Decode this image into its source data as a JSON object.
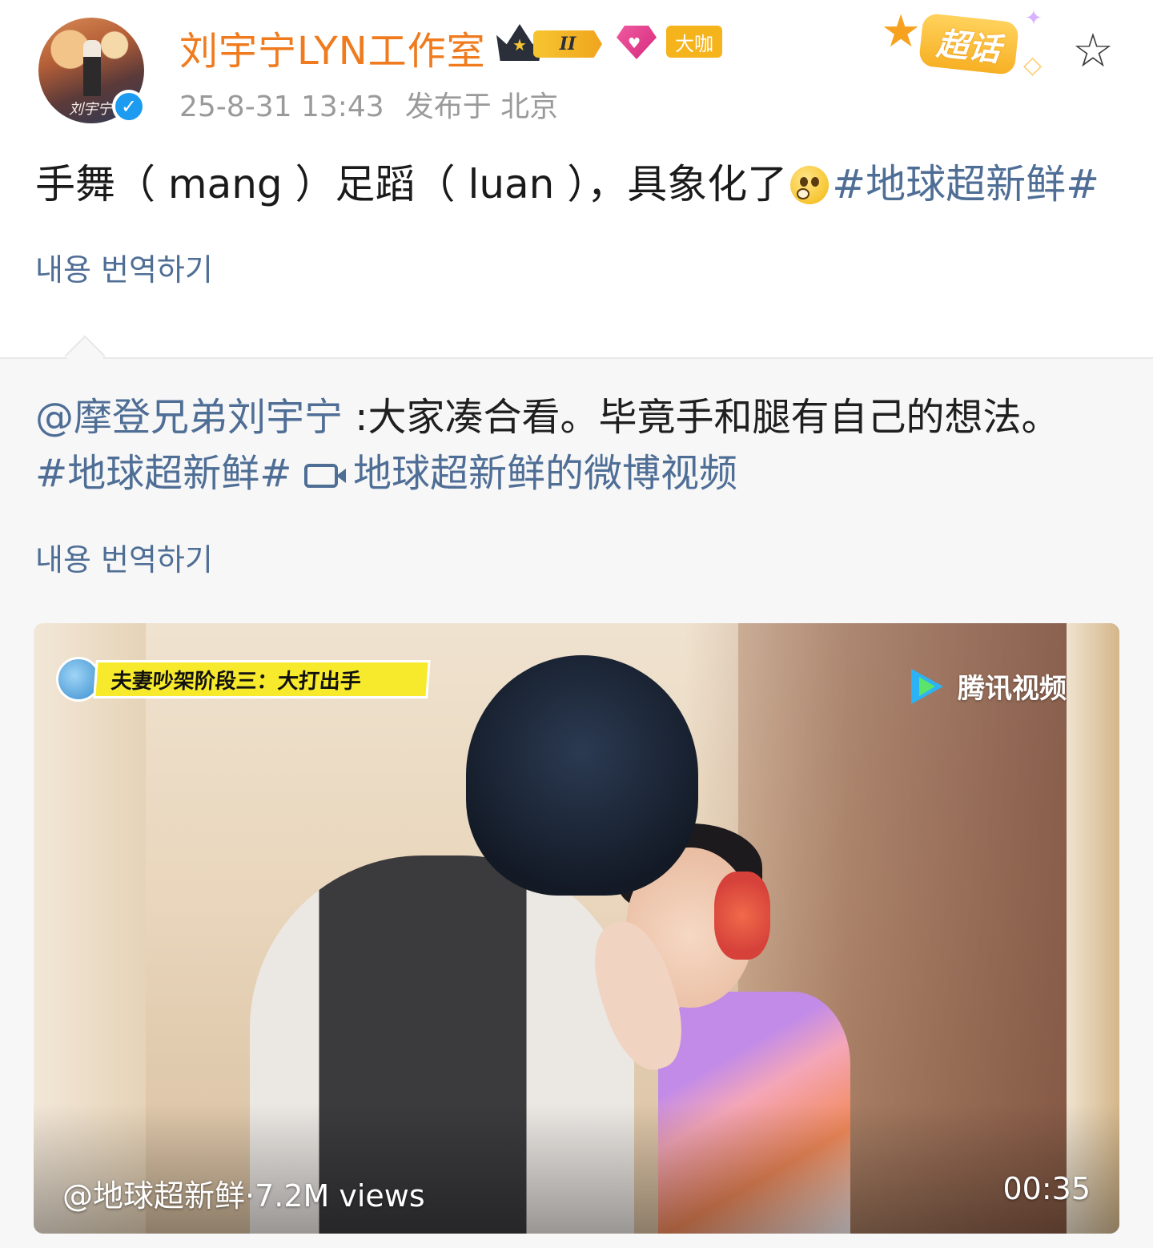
{
  "header": {
    "username": "刘宇宁LYN工作室",
    "timestamp": "25-8-31 13:43",
    "location": "发布于 北京",
    "badges": {
      "rank_label": "II",
      "daka_label": "大咖",
      "supertopic_label": "超话"
    },
    "avatar_signature": "刘宇宁",
    "icons": {
      "verified": "verified-check-icon",
      "favorite": "star-outline-icon"
    },
    "colors": {
      "username": "#f07b1e",
      "verified": "#1c9bf0",
      "link": "#4f6e96"
    }
  },
  "post": {
    "text_main": "手舞（ mang ）足蹈（ luan ），具象化了",
    "emoji": "thinking-face-emoji",
    "hashtag": "#地球超新鲜#",
    "translate_label": "내용 번역하기"
  },
  "retweet": {
    "mention": "@摩登兄弟刘宇宁",
    "text": " :大家凑合看。毕竟手和腿有自己的想法。 ",
    "hashtag": "#地球超新鲜#",
    "video_link": "地球超新鲜的微博视频",
    "translate_label": "내용 번역하기",
    "video": {
      "caption": "夫妻吵架阶段三：大打出手",
      "watermark": "腾讯视频",
      "source": "@地球超新鲜·7.2M views",
      "duration": "00:35"
    }
  }
}
